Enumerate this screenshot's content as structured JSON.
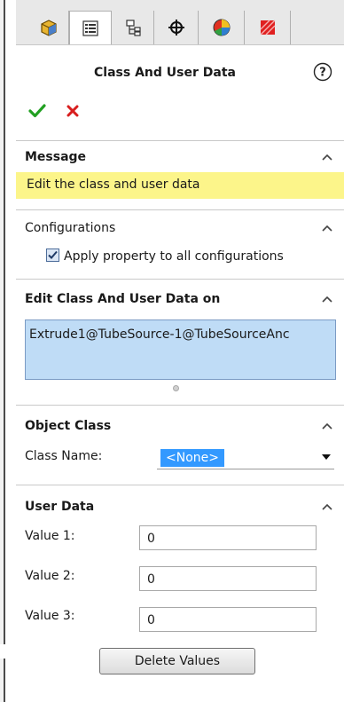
{
  "panel": {
    "title": "Class And User Data"
  },
  "tabs": [
    {
      "icon": "feature-manager-icon"
    },
    {
      "icon": "property-manager-icon"
    },
    {
      "icon": "configuration-manager-icon"
    },
    {
      "icon": "dimxpert-icon"
    },
    {
      "icon": "display-manager-icon"
    },
    {
      "icon": "routing-icon"
    }
  ],
  "message": {
    "header": "Message",
    "text": "Edit the class and user data",
    "highlight_color": "#fcf58a"
  },
  "configurations": {
    "header": "Configurations",
    "checkbox_label": "Apply property to all configurations",
    "checked": true
  },
  "edit_on": {
    "header": "Edit Class And User Data on",
    "item": "Extrude1@TubeSource-1@TubeSourceAnc"
  },
  "object_class": {
    "header": "Object Class",
    "class_name_label": "Class Name:",
    "class_name_value": "<None>"
  },
  "user_data": {
    "header": "User Data",
    "fields": [
      {
        "label": "Value 1:",
        "value": "0"
      },
      {
        "label": "Value 2:",
        "value": "0"
      },
      {
        "label": "Value 3:",
        "value": "0"
      }
    ],
    "delete_button": "Delete Values"
  },
  "colors": {
    "selection_blue": "#3399ff",
    "listbox_bg": "#bfdcf6",
    "ok_green": "#22a022",
    "cancel_red": "#d81e1e"
  }
}
